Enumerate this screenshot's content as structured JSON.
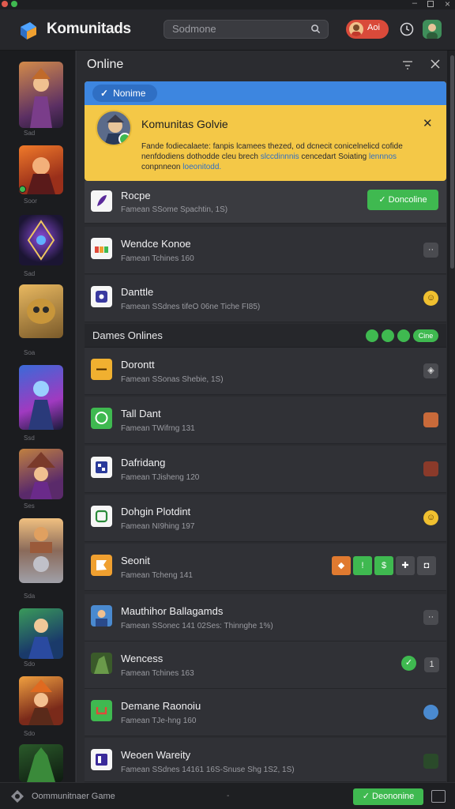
{
  "app": {
    "name": "Komunitads",
    "search_placeholder": "Sodmone",
    "user_pill": "Aoi"
  },
  "panel": {
    "title": "Online",
    "banner": {
      "tab": "Nonime",
      "title": "Komunitas Golvie",
      "text_a": "Fande fodiecalaete: fanpis lcamees thezed, od dcnecit conicelnelicd cofide nenfdodiens dothodde cleu brech ",
      "text_link1": "slccdinnnis",
      "text_b": " cencedart Soiating ",
      "text_link2": "lennnos",
      "text_c": " conpnneon ",
      "text_link3": "loeonitodd."
    },
    "rows": [
      {
        "title": "Rocpe",
        "sub": "Famean SSome Spachtin, 1S)",
        "action": "Doncoline"
      },
      {
        "title": "Wendce Konoe",
        "sub": "Famean Tchines 160"
      },
      {
        "title": "Danttle",
        "sub": "Famean SSdnes tifeO 06ne Tiche FI85)"
      },
      {
        "title": "Dorontt",
        "sub": "Famean SSonas Shebie, 1S)"
      },
      {
        "title": "Tall Dant",
        "sub": "Famean TWifrng 131"
      },
      {
        "title": "Dafridang",
        "sub": "Famean TJisheng 120"
      },
      {
        "title": "Dohgin Plotdint",
        "sub": "Famean NI9hing 197"
      },
      {
        "title": "Seonit",
        "sub": "Famean Tcheng 141"
      },
      {
        "title": "Mauthihor Ballagamds",
        "sub": "Famean SSonec 141 02Ses: Thinnghe 1%)"
      },
      {
        "title": "Wencess",
        "sub": "Famean Tchines 163"
      },
      {
        "title": "Demane Raonoiu",
        "sub": "Famean TJe-hng 160"
      },
      {
        "title": "Weoen Wareity",
        "sub": "Famean SSdnes 14161 16S-Snuse Shg 1S2, 1S)"
      }
    ],
    "section": {
      "title": "Dames Onlines",
      "chip": "Cine"
    },
    "game_labels": [
      "Sad",
      "Soor",
      "Sad",
      "Soa",
      "Ssd",
      "Ses",
      "Sda",
      "Sdo",
      "Sdo"
    ]
  },
  "footer": {
    "title": "Oommunitnaer Game",
    "dot": "-",
    "button": "Deononine"
  },
  "colors": {
    "accent": "#3fb950",
    "banner_blue": "#3d86e0",
    "banner_yellow": "#f4c847",
    "pill_red": "#d94a3a"
  }
}
